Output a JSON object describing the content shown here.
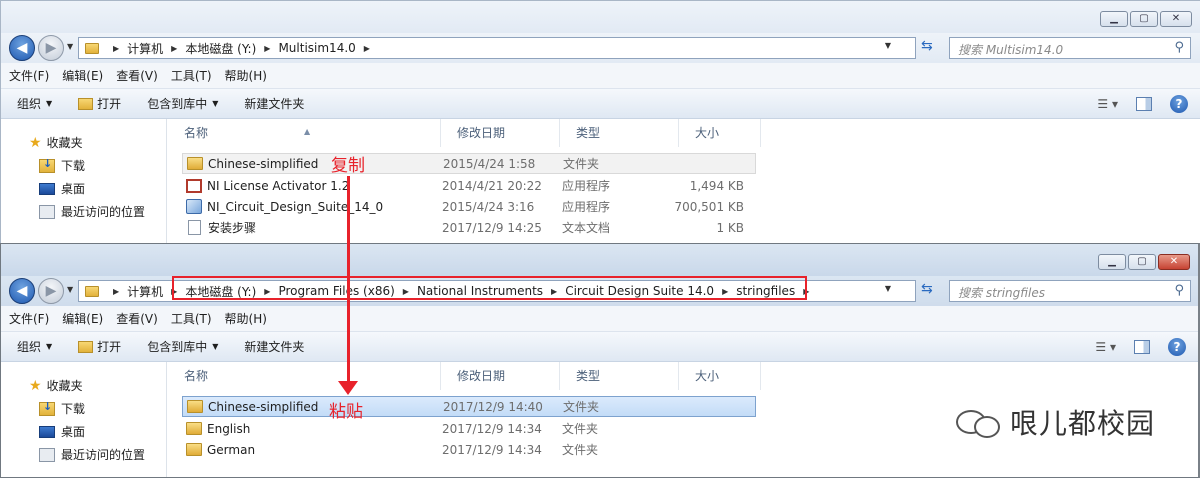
{
  "window1": {
    "nav": {
      "back_icon": "back-arrow-icon",
      "forward_icon": "forward-arrow-icon"
    },
    "breadcrumb": [
      "计算机",
      "本地磁盘 (Y:)",
      "Multisim14.0"
    ],
    "search_placeholder": "搜索 Multisim14.0",
    "menu": [
      "文件(F)",
      "编辑(E)",
      "查看(V)",
      "工具(T)",
      "帮助(H)"
    ],
    "commands": {
      "organize": "组织",
      "open": "打开",
      "include_library": "包含到库中",
      "new_folder": "新建文件夹"
    },
    "sidebar": {
      "favorites": "收藏夹",
      "downloads": "下载",
      "desktop": "桌面",
      "recent": "最近访问的位置"
    },
    "columns": {
      "name": "名称",
      "date": "修改日期",
      "type": "类型",
      "size": "大小"
    },
    "files": [
      {
        "name": "Chinese-simplified",
        "date": "2015/4/24 1:58",
        "type": "文件夹",
        "size": "",
        "icon": "folder-icon"
      },
      {
        "name": "NI License Activator 1.2",
        "date": "2014/4/21 20:22",
        "type": "应用程序",
        "size": "1,494 KB",
        "icon": "app-icon"
      },
      {
        "name": "NI_Circuit_Design_Suite_14_0",
        "date": "2015/4/24 3:16",
        "type": "应用程序",
        "size": "700,501 KB",
        "icon": "setup-icon"
      },
      {
        "name": "安装步骤",
        "date": "2017/12/9 14:25",
        "type": "文本文档",
        "size": "1 KB",
        "icon": "text-file-icon"
      }
    ]
  },
  "window2": {
    "breadcrumb_computer": "计算机",
    "breadcrumb": [
      "本地磁盘 (Y:)",
      "Program Files (x86)",
      "National Instruments",
      "Circuit Design Suite 14.0",
      "stringfiles"
    ],
    "search_placeholder": "搜索 stringfiles",
    "menu": [
      "文件(F)",
      "编辑(E)",
      "查看(V)",
      "工具(T)",
      "帮助(H)"
    ],
    "commands": {
      "organize": "组织",
      "open": "打开",
      "include_library": "包含到库中",
      "new_folder": "新建文件夹"
    },
    "sidebar": {
      "favorites": "收藏夹",
      "downloads": "下载",
      "desktop": "桌面",
      "recent": "最近访问的位置"
    },
    "columns": {
      "name": "名称",
      "date": "修改日期",
      "type": "类型",
      "size": "大小"
    },
    "files": [
      {
        "name": "Chinese-simplified",
        "date": "2017/12/9 14:40",
        "type": "文件夹"
      },
      {
        "name": "English",
        "date": "2017/12/9 14:34",
        "type": "文件夹"
      },
      {
        "name": "German",
        "date": "2017/12/9 14:34",
        "type": "文件夹"
      }
    ]
  },
  "annotations": {
    "copy": "复制",
    "paste": "粘贴",
    "accent_color": "#e8222b"
  },
  "watermark": {
    "text": "哏儿都校园"
  }
}
